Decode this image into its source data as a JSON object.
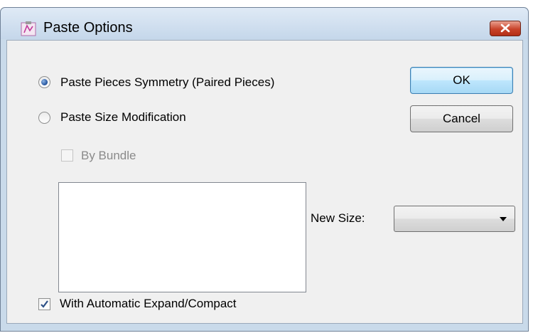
{
  "window": {
    "title": "Paste Options"
  },
  "options": {
    "paste_symmetry": {
      "label": "Paste Pieces Symmetry (Paired Pieces)",
      "selected": true
    },
    "paste_size": {
      "label": "Paste Size Modification",
      "selected": false
    },
    "by_bundle": {
      "label": "By Bundle",
      "checked": false,
      "disabled": true
    },
    "auto_expand": {
      "label": "With Automatic Expand/Compact",
      "checked": true
    }
  },
  "buttons": {
    "ok": "OK",
    "cancel": "Cancel"
  },
  "size_list": {
    "items": []
  },
  "new_size": {
    "label": "New Size:",
    "value": ""
  },
  "icons": {
    "app": "app-icon",
    "close": "close-icon",
    "dropdown": "chevron-down-icon"
  },
  "colors": {
    "accent": "#1f4f9a",
    "close": "#c8432a"
  }
}
